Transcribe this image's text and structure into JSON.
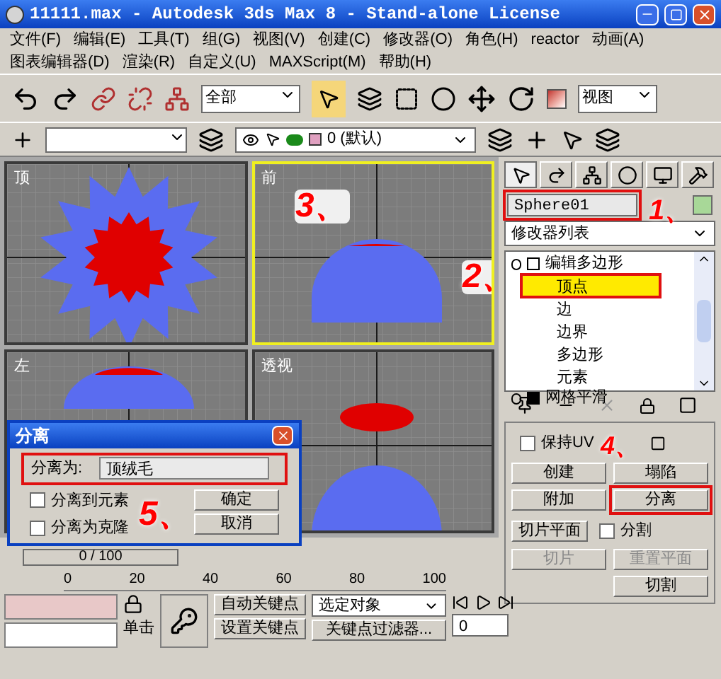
{
  "window": {
    "title": "11111.max - Autodesk 3ds Max 8  - Stand-alone License"
  },
  "menu_rows": [
    [
      "文件(F)",
      "编辑(E)",
      "工具(T)",
      "组(G)",
      "视图(V)",
      "创建(C)",
      "修改器(O)",
      "角色(H)",
      "reactor",
      "动画(A)"
    ],
    [
      "图表编辑器(D)",
      "渲染(R)",
      "自定义(U)",
      "MAXScript(M)",
      "帮助(H)"
    ]
  ],
  "toolbar": {
    "selection_filter": "全部",
    "select_tool_active": true,
    "coordinate_system": "视图"
  },
  "layer_toolbar": {
    "layer": "0 (默认)"
  },
  "viewports": [
    {
      "label": "顶",
      "kind": "top",
      "active": false
    },
    {
      "label": "前",
      "kind": "front",
      "active": true
    },
    {
      "label": "左",
      "kind": "left",
      "active": false
    },
    {
      "label": "透视",
      "kind": "perspective",
      "active": false
    }
  ],
  "command_panel": {
    "tabs": [
      {
        "selected": true
      },
      {
        "selected": false
      },
      {
        "selected": false
      },
      {
        "selected": false
      },
      {
        "selected": false
      },
      {
        "selected": false
      }
    ],
    "object_name": "Sphere01",
    "modifier_list": "修改器列表",
    "modifier_stack": [
      {
        "label": "编辑多边形",
        "expanded": true,
        "children": [
          {
            "label": "顶点",
            "selected": true
          },
          {
            "label": "边",
            "selected": false
          },
          {
            "label": "边界",
            "selected": false
          },
          {
            "label": "多边形",
            "selected": false
          },
          {
            "label": "元素",
            "selected": false
          }
        ]
      },
      {
        "label": "网格平滑",
        "expanded": false
      }
    ],
    "preserve_uv": {
      "label": "保持UV",
      "checked": false
    },
    "buttons_row1": [
      "创建",
      "塌陷"
    ],
    "attach": "附加",
    "detach": "分离",
    "slice_plane": "切片平面",
    "split": {
      "label": "分割",
      "checked": false
    },
    "disabled_buttons": [
      "切片",
      "重置平面"
    ],
    "cut": "切割"
  },
  "dialog": {
    "title": "分离",
    "field_label": "分离为:",
    "value": "顶绒毛",
    "options": [
      {
        "label": "分离到元素",
        "checked": false
      },
      {
        "label": "分离为克隆",
        "checked": false
      }
    ],
    "buttons": [
      "确定",
      "取消"
    ]
  },
  "track_bar": {
    "frame": "0 / 100"
  },
  "timeline_ticks": [
    "0",
    "20",
    "40",
    "60",
    "80",
    "100"
  ],
  "status": {
    "prompt": "单击",
    "auto_key": "自动关键点",
    "set_key": "设置关键点",
    "key_mode": "选定对象",
    "key_filters": "关键点过滤器...",
    "frame": "0"
  },
  "annotations": [
    "1、",
    "2、",
    "3、",
    "4、",
    "5、"
  ]
}
